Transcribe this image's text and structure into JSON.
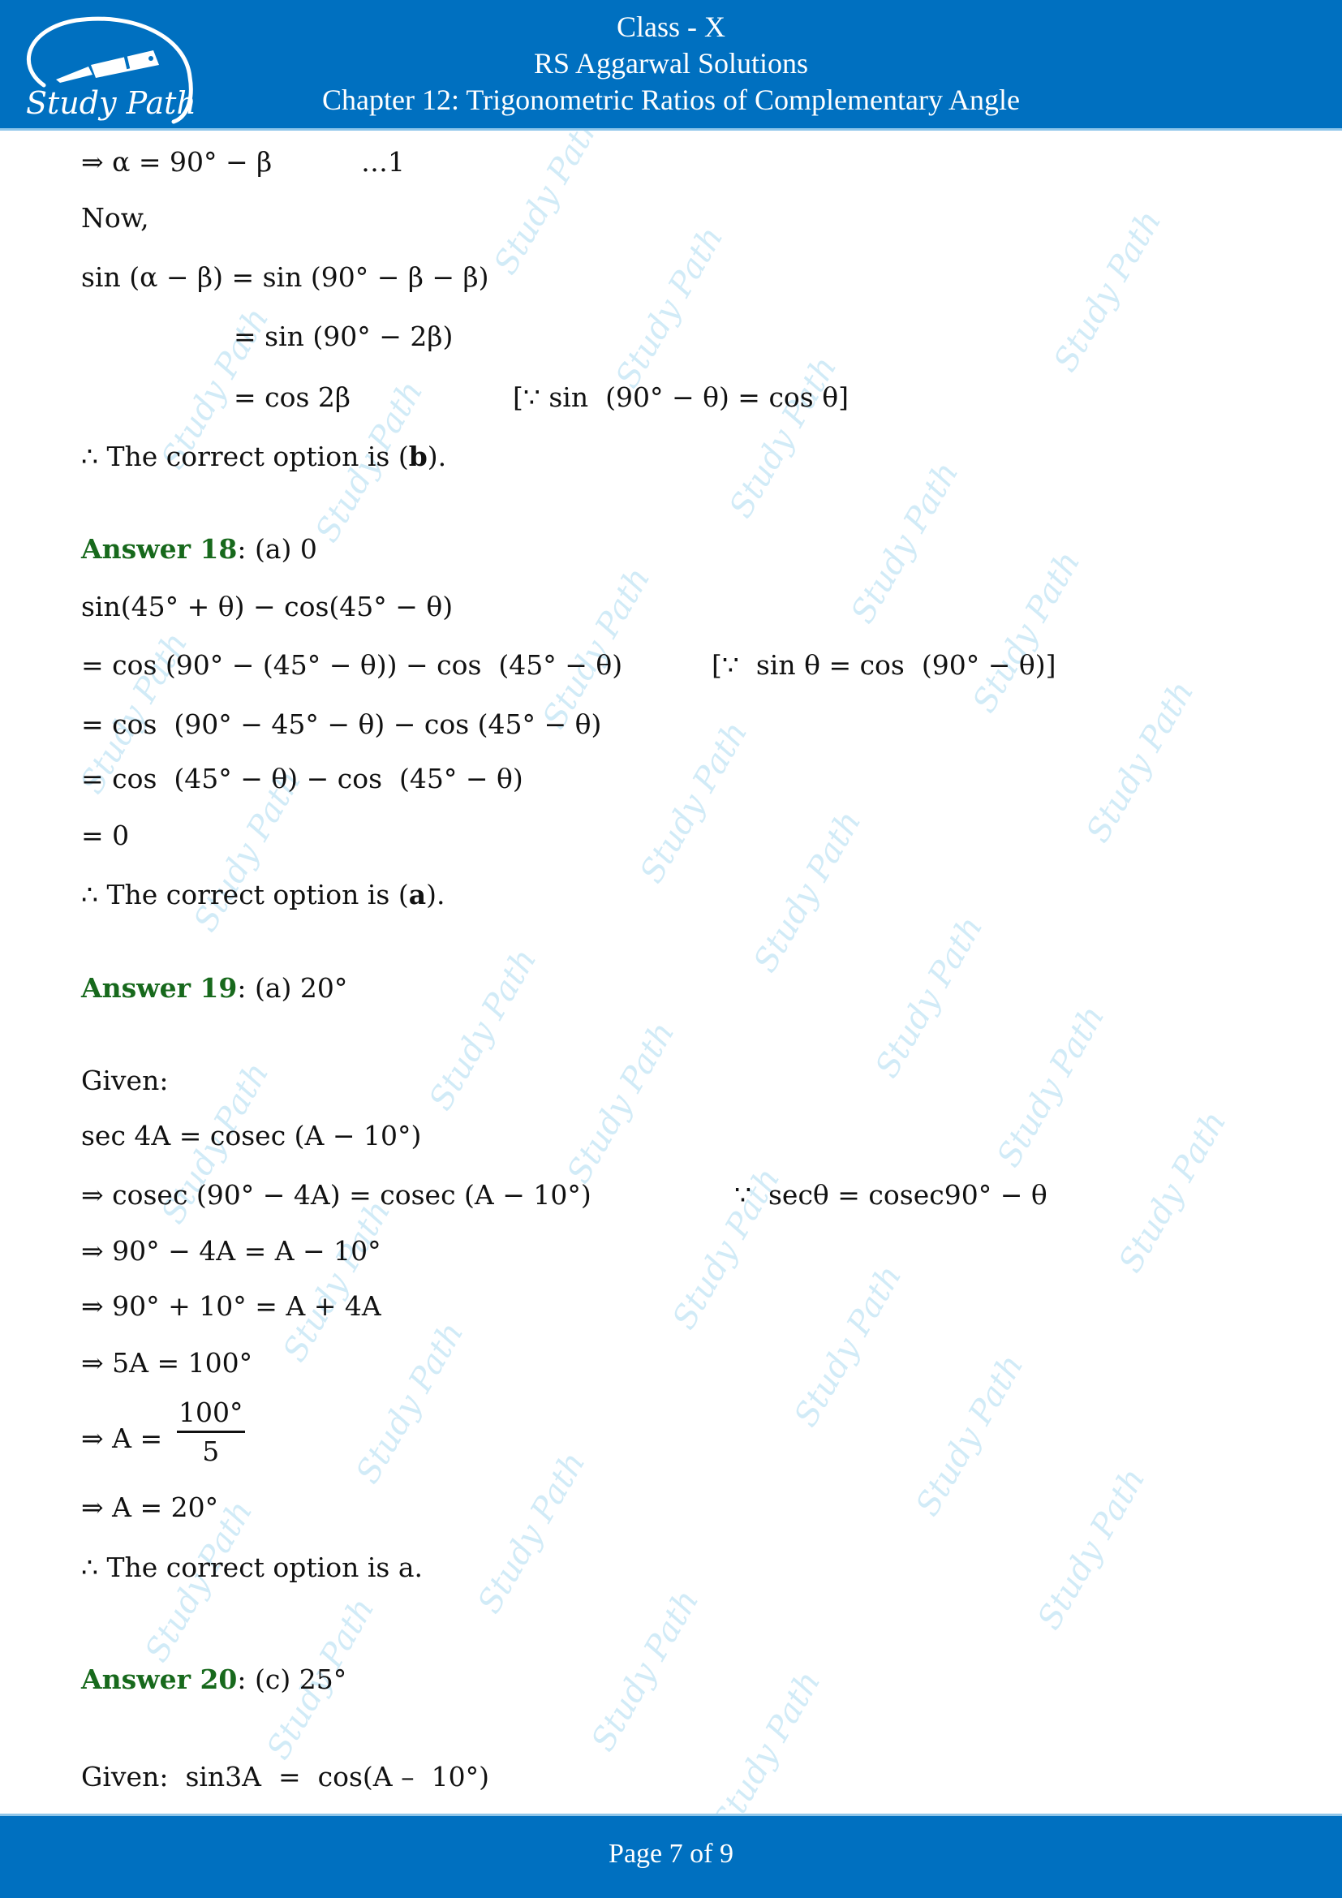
{
  "header": {
    "logo_text": "Study Path",
    "line1": "Class - X",
    "line2": "RS Aggarwal Solutions",
    "line3": "Chapter 12: Trigonometric Ratios of Complementary Angle",
    "background": "#0070c0"
  },
  "content": {
    "q17_continued": {
      "line1": "⇒ α = 90° − β",
      "line1_ref": "…1",
      "now": "Now,",
      "step1": "sin (α − β) = sin (90° − β − β)",
      "step2": "= sin (90° − 2β)",
      "step3": "= cos 2β",
      "step3_reason": "[∵ sin  (90° − θ) = cos θ]",
      "conclusion_prefix": "∴ The correct option is (",
      "conclusion_option": "b",
      "conclusion_suffix": ")."
    },
    "answer18": {
      "label": "Answer 18",
      "answer": ": (a) 0",
      "lines": [
        "sin(45° + θ) − cos(45° − θ)",
        "= cos (90° − (45° − θ)) − cos  (45° − θ)",
        "= cos  (90° − 45° − θ) − cos (45° − θ)",
        "= cos  (45° − θ) − cos  (45° − θ)",
        "= 0"
      ],
      "reason": "[∵  sin θ = cos  (90° − θ)]",
      "conclusion_prefix": "∴ The correct option is (",
      "conclusion_option": "a",
      "conclusion_suffix": ")."
    },
    "answer19": {
      "label": "Answer 19",
      "answer": ": (a) 20°",
      "given": "Given:",
      "lines": [
        "sec 4A = cosec (A − 10°)",
        "⇒ cosec (90° − 4A) = cosec (A − 10°)",
        "⇒ 90° − 4A = A − 10°",
        "⇒ 90° + 10° = A + 4A",
        "⇒ 5A = 100°"
      ],
      "reason": "∵  secθ = cosec90° − θ",
      "fraction_lhs": "⇒ A =",
      "fraction_num": "100°",
      "fraction_den": "5",
      "result": "⇒ A = 20°",
      "conclusion": "∴ The correct option is a."
    },
    "answer20": {
      "label": "Answer 20",
      "answer": ": (c) 25°",
      "given": "Given:  sin3A  =  cos(A –  10°)"
    }
  },
  "footer": {
    "page_label": "Page 7 of 9"
  },
  "watermark": {
    "text": "Study Path",
    "color": "#cde9f7"
  },
  "colors": {
    "answer_label": "#17691c",
    "header_footer": "#0070c0"
  }
}
